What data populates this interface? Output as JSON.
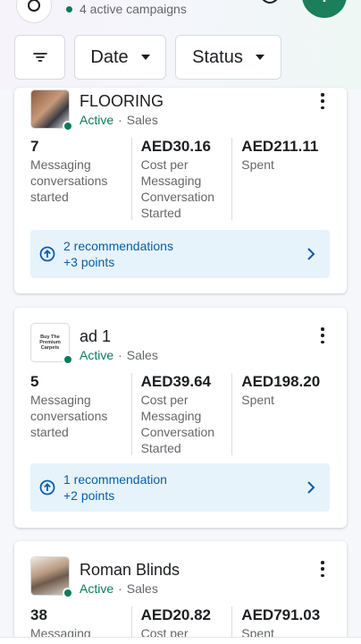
{
  "header": {
    "campaign_count": "4 active campaigns"
  },
  "filters": {
    "date_label": "Date",
    "status_label": "Status"
  },
  "cards": [
    {
      "title": "FLOORING",
      "status": "Active",
      "separator": "·",
      "type": "Sales",
      "metrics": [
        {
          "value": "7",
          "label": "Messaging conversations started"
        },
        {
          "value": "AED30.16",
          "label": "Cost per Messaging Conversation Started"
        },
        {
          "value": "AED211.11",
          "label": "Spent"
        }
      ],
      "reco_title": "2 recommendations",
      "reco_points": "+3 points"
    },
    {
      "title": "ad 1",
      "status": "Active",
      "separator": "·",
      "type": "Sales",
      "metrics": [
        {
          "value": "5",
          "label": "Messaging conversations started"
        },
        {
          "value": "AED39.64",
          "label": "Cost per Messaging Conversation Started"
        },
        {
          "value": "AED198.20",
          "label": "Spent"
        }
      ],
      "reco_title": "1 recommendation",
      "reco_points": "+2 points",
      "thumb_text": "Buy The Premium Carpets"
    },
    {
      "title": "Roman Blinds",
      "status": "Active",
      "separator": "·",
      "type": "Sales",
      "metrics": [
        {
          "value": "38",
          "label": "Messaging"
        },
        {
          "value": "AED20.82",
          "label": "Cost per"
        },
        {
          "value": "AED791.03",
          "label": "Spent"
        }
      ]
    }
  ],
  "colors": {
    "active": "#0a7c5a",
    "recommendation_bg": "#e7f3fb",
    "recommendation_text": "#0a5ea8",
    "fab": "#1a7f5a"
  },
  "icons": {
    "top_left": "campaign-settings-icon",
    "notification": "bell-icon",
    "fab": "plus-icon",
    "filter": "filter-lines-icon",
    "recommendation": "arrow-up-circle-icon",
    "chevron": "chevron-right-icon"
  }
}
